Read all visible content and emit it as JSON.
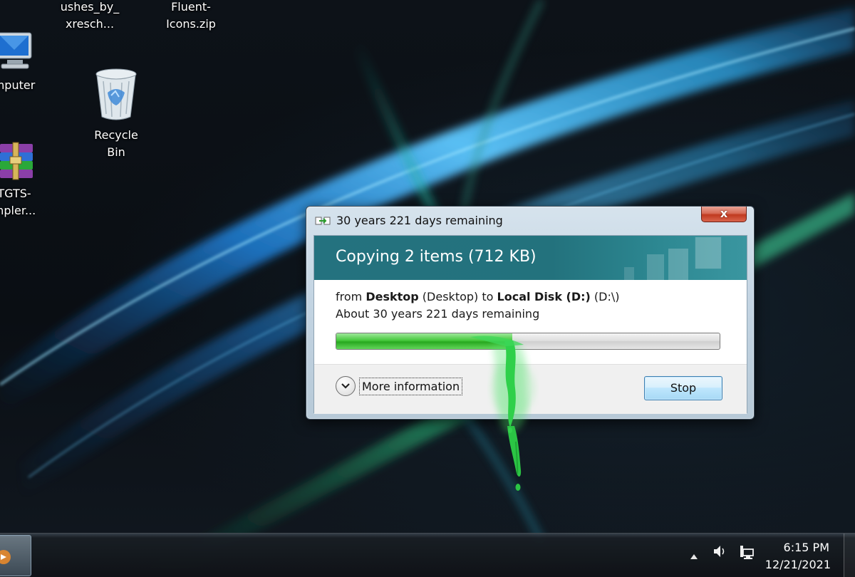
{
  "desktop": {
    "icons": [
      {
        "label_1": "ushes_by_",
        "label_2": "xresch..."
      },
      {
        "label_1": "Fluent-",
        "label_2": "Icons.zip"
      },
      {
        "label_1": "mputer",
        "label_2": ""
      },
      {
        "label_1": "Recycle",
        "label_2": "Bin"
      },
      {
        "label_1": "TGTS-",
        "label_2": "mpler..."
      }
    ]
  },
  "dialog": {
    "title": "30 years 221 days remaining",
    "close_label": "x",
    "header": "Copying 2 items (712 KB)",
    "from_prefix": "from ",
    "source_bold": "Desktop",
    "source_paren": " (Desktop) to ",
    "dest_bold": "Local Disk (D:)",
    "dest_paren": " (D:\\)",
    "remaining": "About 30 years 221 days remaining",
    "progress_fraction": 0.46,
    "more_info_label": "More information",
    "stop_label": "Stop"
  },
  "taskbar": {
    "time": "6:15 PM",
    "date": "12/21/2021",
    "tray_icons": [
      "show-hidden-icons-arrow",
      "volume-icon",
      "network-icon"
    ]
  },
  "colors": {
    "header_band": "#24727f",
    "progress_green": "#28a81f",
    "goo_green": "#2fd04a"
  }
}
